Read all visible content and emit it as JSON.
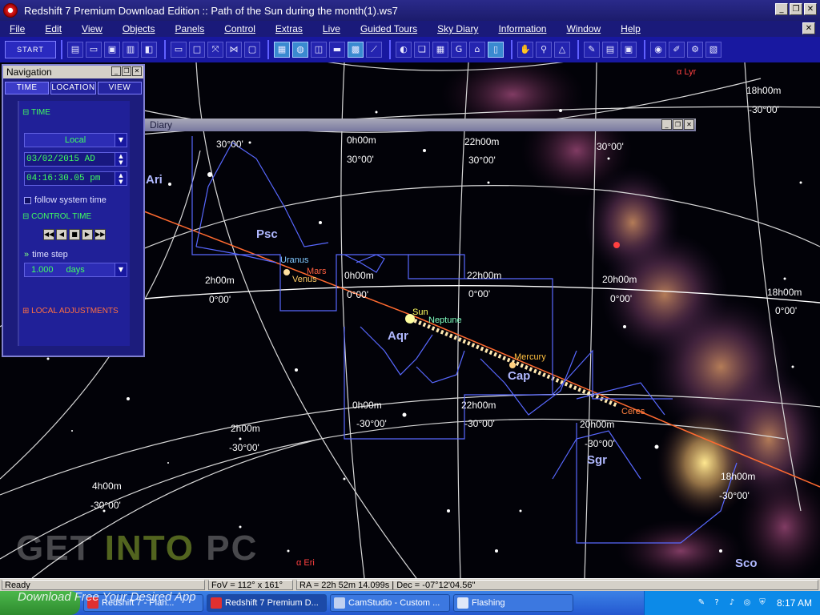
{
  "window": {
    "title": "Redshift 7 Premium Download Edition :: Path of the Sun during the month(1).ws7",
    "controls": [
      "_",
      "❐",
      "✕"
    ]
  },
  "menu": [
    "File",
    "Edit",
    "View",
    "Objects",
    "Panels",
    "Control",
    "Extras",
    "Live",
    "Guided Tours",
    "Sky Diary",
    "Information",
    "Window",
    "Help"
  ],
  "toolbar": {
    "start_label": "START",
    "icons": [
      "new-doc-icon",
      "open-icon",
      "save-icon",
      "print-icon",
      "export-icon",
      "monitor-icon",
      "window-icon",
      "fullscreen-icon",
      "split-icon",
      "snapshot-icon",
      "panorama-icon",
      "globe-icon",
      "compare-icon",
      "chart-icon",
      "calendar-icon",
      "tool-icon",
      "eye-icon",
      "layers-icon",
      "grid-icon",
      "gravity-icon",
      "home-icon",
      "time-icon",
      "hand-icon",
      "zoom-icon",
      "measure-icon",
      "pen-icon",
      "note-icon",
      "photo-icon",
      "record-icon",
      "edit-icon",
      "settings-icon",
      "close-doc-icon"
    ]
  },
  "nav": {
    "title": "Navigation",
    "tabs": [
      "TIME",
      "LOCATION",
      "VIEW"
    ],
    "time_section": "TIME",
    "time_zone": "Local",
    "date": "03/02/2015 AD",
    "time": "04:16:30.05 pm",
    "follow_label": "follow system time",
    "control_section": "CONTROL TIME",
    "time_step_label": "time step",
    "time_step_value": "1.000",
    "time_step_unit": "days",
    "local_adj": "LOCAL ADJUSTMENTS"
  },
  "diary": {
    "title": "Diary"
  },
  "sky": {
    "constellations": [
      "Psc",
      "Aqr",
      "Cap",
      "Sgr",
      "Sco",
      "Ari"
    ],
    "planets": [
      "Uranus",
      "Mars",
      "Venus",
      "Sun",
      "Neptune",
      "Mercury",
      "Ceres"
    ],
    "stars": [
      "α Eri",
      "α Lyr"
    ],
    "ra_labels": [
      "0h00m",
      "22h00m",
      "2h00m",
      "20h00m",
      "18h00m",
      "4h00m",
      "20h00m",
      "22h00m",
      "0h00m",
      "18h00m",
      "0h00m",
      "22h00m",
      "20h00m",
      "18h00m",
      "2h00m"
    ],
    "dec_labels": [
      "30°00'",
      "30°00'",
      "30°00'",
      "30°00'",
      "-30°00'",
      "0°00'",
      "0°00'",
      "0°00'",
      "0°00'",
      "-30°00'",
      "-30°00'",
      "-30°00'",
      "-30°00'",
      "-30°00'",
      "-30°00'"
    ]
  },
  "status": {
    "ready": "Ready",
    "fov": "FoV = 112° x 161°",
    "coords": "RA = 22h 52m 14.099s | Dec = -07°12'04.56\""
  },
  "taskbar": {
    "tasks": [
      "Redshift 7 - Plan...",
      "Redshift 7 Premium D...",
      "CamStudio - Custom ...",
      "Flashing"
    ],
    "time": "8:17 AM"
  },
  "watermark": {
    "line1a": "GET",
    "line1b": "INTO",
    "line1c": "PC",
    "line2": "Download Free Your Desired App"
  },
  "colors": {
    "ecliptic": "#ff6633",
    "equator": "#ffffff",
    "grid": "#e0e0e0",
    "constellation_lines": "#5a6aff",
    "accent_green": "#40ff60"
  }
}
